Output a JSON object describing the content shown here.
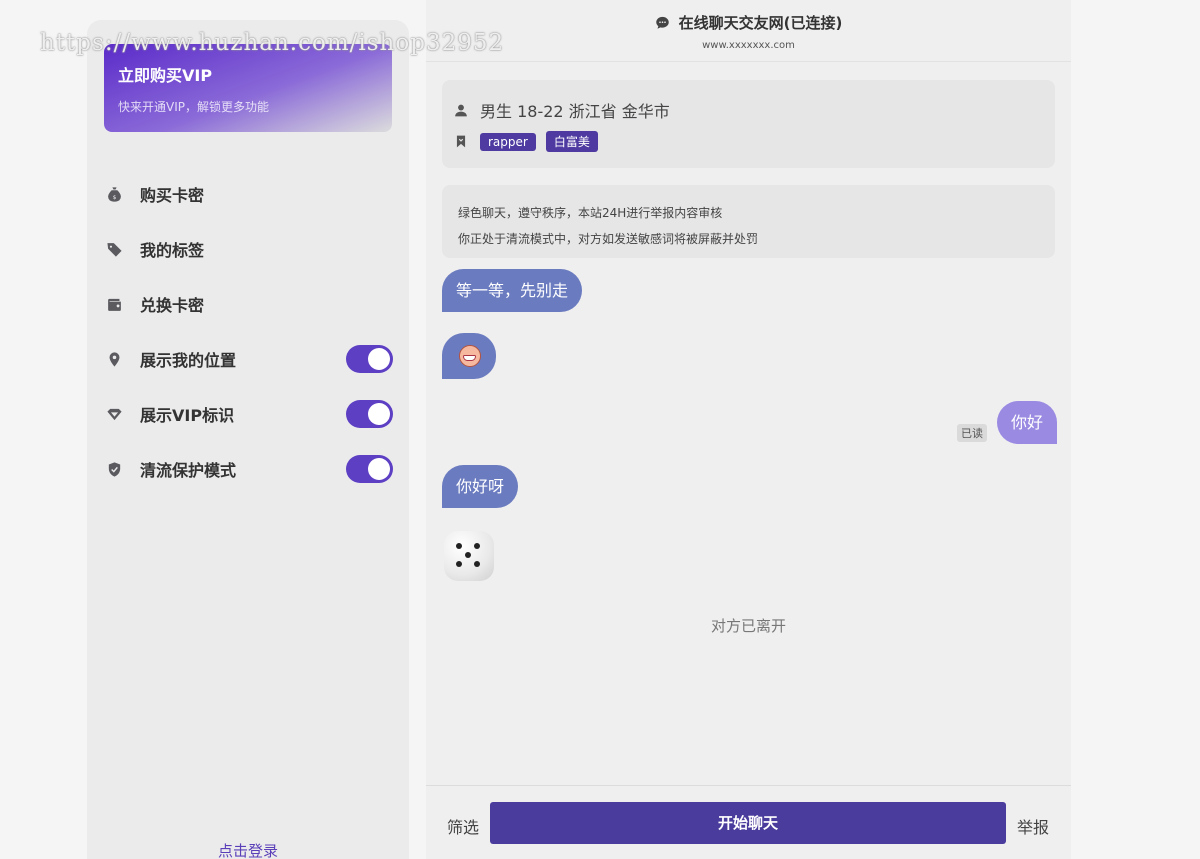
{
  "watermark": "https://www.huzhan.com/ishop32952",
  "sidebar": {
    "vip_card": {
      "title": "立即购买VIP",
      "subtitle": "快来开通VIP，解锁更多功能"
    },
    "items": [
      {
        "label": "购买卡密",
        "icon": "money-bag-icon",
        "toggle": null
      },
      {
        "label": "我的标签",
        "icon": "tag-icon",
        "toggle": null
      },
      {
        "label": "兑换卡密",
        "icon": "wallet-icon",
        "toggle": null
      },
      {
        "label": "展示我的位置",
        "icon": "location-pin-icon",
        "toggle": true
      },
      {
        "label": "展示VIP标识",
        "icon": "diamond-icon",
        "toggle": true
      },
      {
        "label": "清流保护模式",
        "icon": "shield-check-icon",
        "toggle": true
      }
    ],
    "login_link": "点击登录"
  },
  "chat": {
    "header": {
      "title": "在线聊天交友网(已连接)",
      "domain": "www.xxxxxxx.com"
    },
    "profile": {
      "info": "男生  18-22  浙江省 金华市",
      "tags": [
        "rapper",
        "白富美"
      ]
    },
    "notice": {
      "line1": "绿色聊天，遵守秩序，本站24H进行举报内容审核",
      "line2": "你正处于清流模式中，对方如发送敏感词将被屏蔽并处罚"
    },
    "messages": [
      {
        "side": "left",
        "type": "text",
        "text": "等一等，先别走"
      },
      {
        "side": "left",
        "type": "emoji",
        "emoji": "grinning-face-emoji"
      },
      {
        "side": "right",
        "type": "text",
        "text": "你好",
        "status": "已读"
      },
      {
        "side": "left",
        "type": "text",
        "text": "你好呀"
      },
      {
        "side": "left",
        "type": "dice",
        "value": 5
      }
    ],
    "left_notice": "对方已离开",
    "footer": {
      "filter_label": "筛选",
      "start_label": "开始聊天",
      "report_label": "举报"
    }
  },
  "colors": {
    "accent": "#5d3fc4",
    "start_button": "#4a3c9c",
    "bubble_left": "#6a7bbf",
    "bubble_right": "#9a8ae2"
  }
}
